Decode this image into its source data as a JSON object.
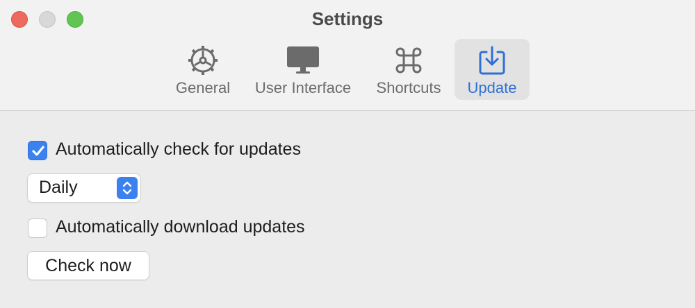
{
  "window": {
    "title": "Settings"
  },
  "toolbar": {
    "tabs": [
      {
        "label": "General",
        "icon": "gear-icon",
        "selected": false
      },
      {
        "label": "User Interface",
        "icon": "display-icon",
        "selected": false
      },
      {
        "label": "Shortcuts",
        "icon": "command-icon",
        "selected": false
      },
      {
        "label": "Update",
        "icon": "download-icon",
        "selected": true
      }
    ]
  },
  "update": {
    "auto_check": {
      "label": "Automatically check for updates",
      "checked": true
    },
    "frequency": {
      "value": "Daily"
    },
    "auto_download": {
      "label": "Automatically download updates",
      "checked": false
    },
    "check_now_label": "Check now"
  },
  "colors": {
    "accent": "#3b82f0",
    "selected_label": "#2f6fd6"
  }
}
